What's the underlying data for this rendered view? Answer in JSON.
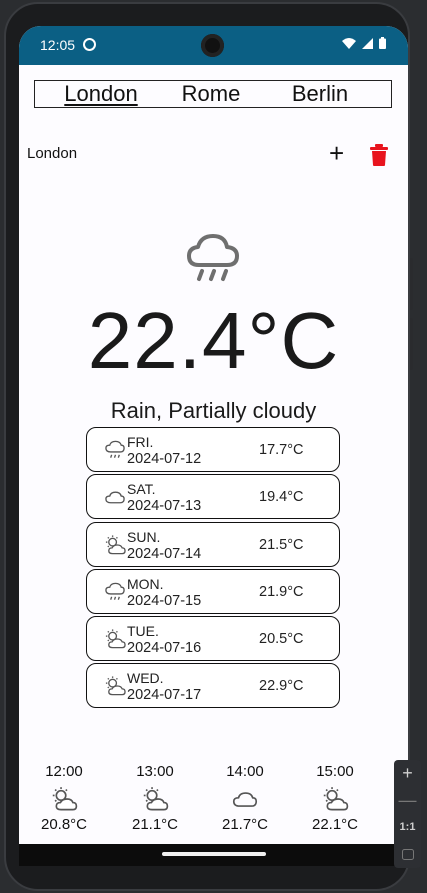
{
  "status_bar": {
    "time": "12:05"
  },
  "tabs": [
    "London",
    "Rome",
    "Berlin"
  ],
  "active_tab": "London",
  "city": {
    "name": "London",
    "add_label": "+"
  },
  "current": {
    "temperature": "22.4°C",
    "condition": "Rain, Partially cloudy",
    "icon": "rain-cloud-icon"
  },
  "forecast": [
    {
      "day": "FRI.",
      "date": "2024-07-12",
      "temp": "17.7°C",
      "icon": "rain-cloud-icon"
    },
    {
      "day": "SAT.",
      "date": "2024-07-13",
      "temp": "19.4°C",
      "icon": "cloud-icon"
    },
    {
      "day": "SUN.",
      "date": "2024-07-14",
      "temp": "21.5°C",
      "icon": "partly-cloudy-icon"
    },
    {
      "day": "MON.",
      "date": "2024-07-15",
      "temp": "21.9°C",
      "icon": "rain-cloud-icon"
    },
    {
      "day": "TUE.",
      "date": "2024-07-16",
      "temp": "20.5°C",
      "icon": "partly-cloudy-icon"
    },
    {
      "day": "WED.",
      "date": "2024-07-17",
      "temp": "22.9°C",
      "icon": "partly-cloudy-icon"
    }
  ],
  "hourly": [
    {
      "time": "12:00",
      "temp": "20.8°C",
      "icon": "partly-cloudy-icon"
    },
    {
      "time": "13:00",
      "temp": "21.1°C",
      "icon": "partly-cloudy-icon"
    },
    {
      "time": "14:00",
      "temp": "21.7°C",
      "icon": "cloud-icon"
    },
    {
      "time": "15:00",
      "temp": "22.1°C",
      "icon": "partly-cloudy-icon"
    }
  ],
  "emulator_zoom": {
    "plus": "+",
    "minus": "—",
    "ratio": "1:1"
  },
  "colors": {
    "status_bar": "#0b5f84",
    "trash": "#e8141e"
  }
}
